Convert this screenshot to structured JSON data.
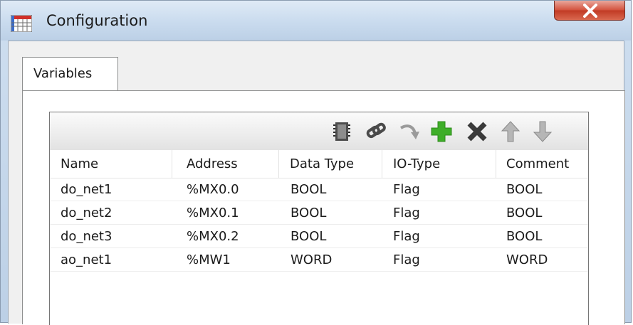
{
  "window": {
    "title": "Configuration",
    "icon": "grid-table-icon",
    "close_icon": "close-icon"
  },
  "tabs": [
    {
      "label": "Variables",
      "selected": true
    }
  ],
  "toolbar": {
    "buttons": [
      {
        "icon": "memory-chip-icon"
      },
      {
        "icon": "link-icon"
      },
      {
        "icon": "arrow-curve-icon"
      },
      {
        "icon": "add-icon"
      },
      {
        "icon": "delete-icon"
      },
      {
        "icon": "arrow-up-icon"
      },
      {
        "icon": "arrow-down-icon"
      }
    ]
  },
  "grid": {
    "columns": [
      "Name",
      "Address",
      "Data Type",
      "IO-Type",
      "Comment"
    ],
    "rows": [
      {
        "name": "do_net1",
        "address": "%MX0.0",
        "data_type": "BOOL",
        "io_type": "Flag",
        "comment": "BOOL"
      },
      {
        "name": "do_net2",
        "address": "%MX0.1",
        "data_type": "BOOL",
        "io_type": "Flag",
        "comment": "BOOL"
      },
      {
        "name": "do_net3",
        "address": "%MX0.2",
        "data_type": "BOOL",
        "io_type": "Flag",
        "comment": "BOOL"
      },
      {
        "name": "ao_net1",
        "address": "%MW1",
        "data_type": "WORD",
        "io_type": "Flag",
        "comment": "WORD"
      }
    ]
  },
  "colors": {
    "add": "#3fae29",
    "delete": "#3a3a3a",
    "arrows": "#9a9a9a",
    "close": "#c93f28"
  }
}
